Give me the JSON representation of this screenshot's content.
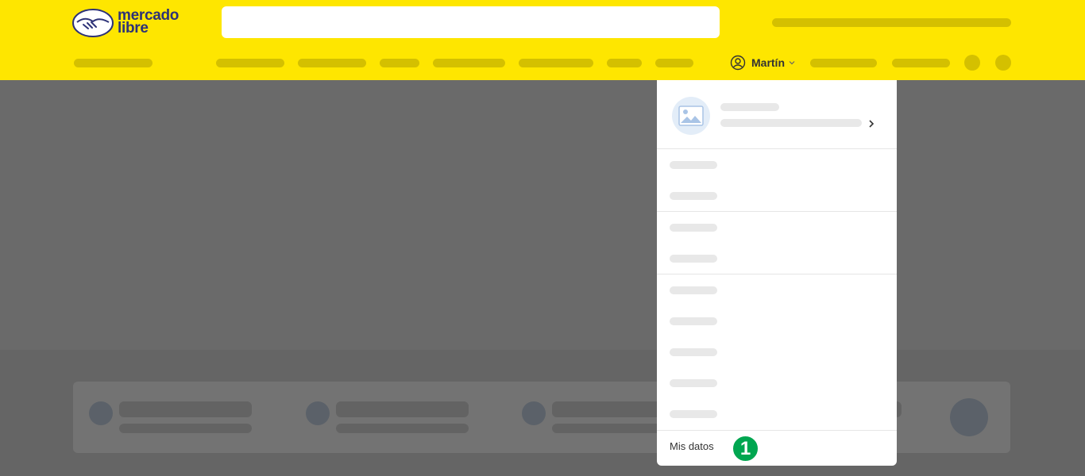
{
  "header": {
    "logo_line1": "mercado",
    "logo_line2": "libre",
    "user_name": "Martín"
  },
  "dropdown": {
    "last_item_label": "Mis datos"
  },
  "badge": {
    "label": "1"
  },
  "colors": {
    "brand_yellow": "#fee600",
    "logo_navy": "#2d3277",
    "badge_green": "#00a650"
  },
  "icons": [
    "handshake-icon",
    "user-icon",
    "chevron-down-icon",
    "image-placeholder-icon",
    "chevron-right-icon"
  ]
}
